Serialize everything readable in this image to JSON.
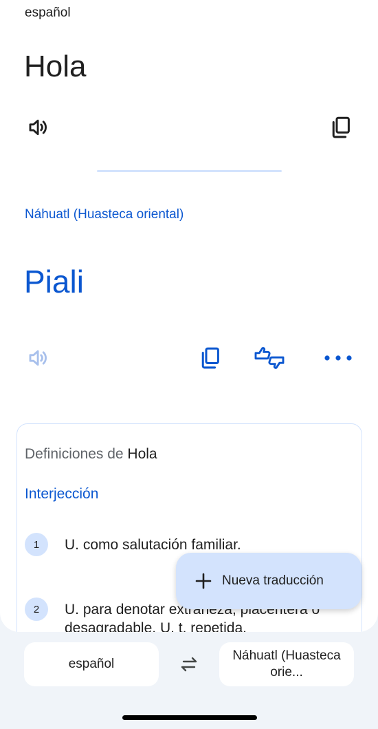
{
  "source": {
    "language": "español",
    "text": "Hola",
    "icons": {
      "speak": "volume-icon",
      "copy": "copy-icon"
    }
  },
  "target": {
    "language": "Náhuatl (Huasteca oriental)",
    "text": "Piali",
    "icons": {
      "speak": "volume-icon",
      "copy": "copy-icon",
      "rate": "thumbs-rating-icon",
      "more": "more-dots-icon"
    }
  },
  "definitions": {
    "title_prefix": "Definiciones de ",
    "title_word": "Hola",
    "part_of_speech": "Interjección",
    "items": [
      {
        "number": "1",
        "text": "U. como salutación familiar."
      },
      {
        "number": "2",
        "text": "U. para denotar extrañeza, placentera o desagradable. U. t. repetida."
      }
    ]
  },
  "fab": {
    "label": "Nueva traducción",
    "icon": "plus-icon"
  },
  "language_bar": {
    "source_label": "español",
    "target_label": "Náhuatl (Huasteca orie...",
    "swap_icon": "swap-arrows-icon"
  },
  "colors": {
    "accent": "#0b57d0",
    "accent_light": "#d3e3fd",
    "text": "#1f1f1f",
    "muted": "#5f6368",
    "background": "#f0f4f9"
  }
}
